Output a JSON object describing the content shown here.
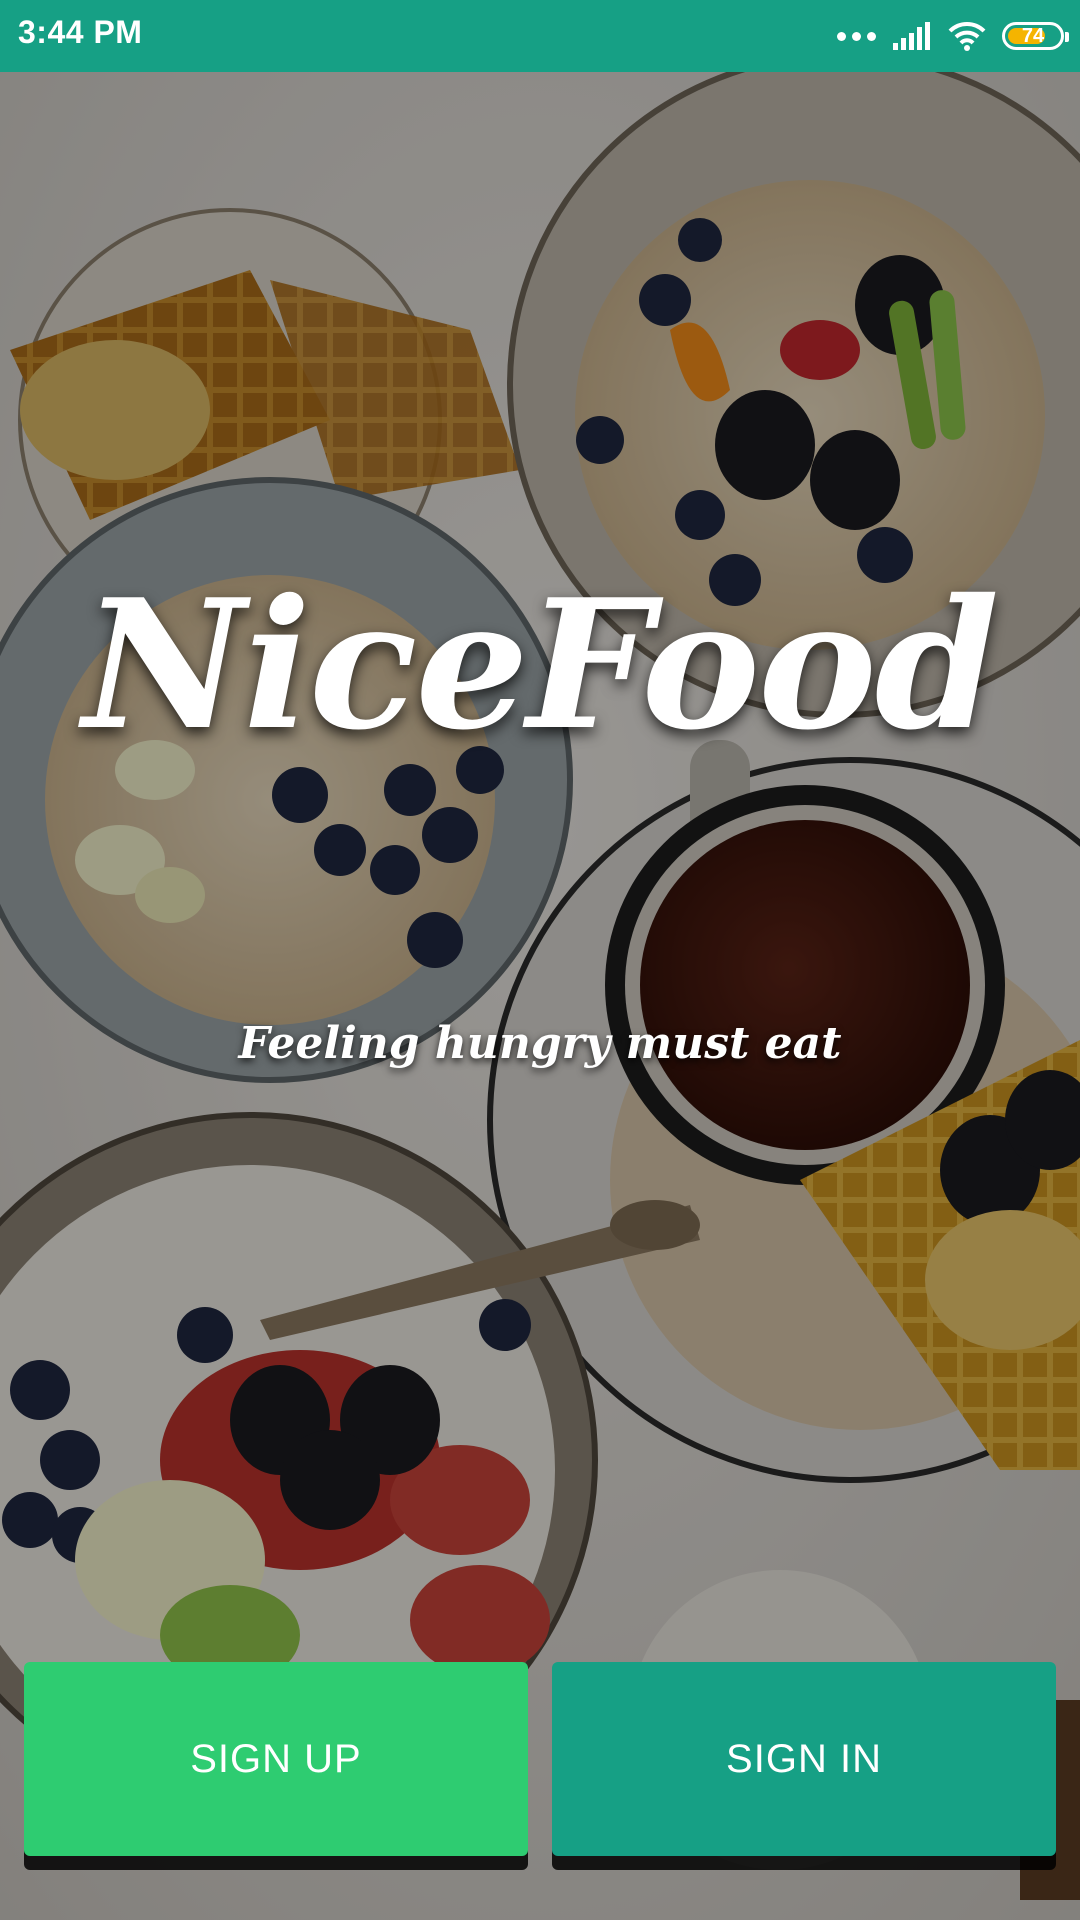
{
  "status_bar": {
    "time": "3:44 PM",
    "battery_level": "74",
    "battery_percent": 74,
    "icons": [
      "more-dots-icon",
      "signal-icon",
      "wifi-icon",
      "battery-icon"
    ]
  },
  "app": {
    "title": "NiceFood",
    "tagline": "Feeling hungry must eat"
  },
  "actions": {
    "sign_up_label": "SIGN UP",
    "sign_in_label": "SIGN IN"
  },
  "colors": {
    "status_bar": "#16a085",
    "sign_up": "#2ecc71",
    "sign_in": "#16a085",
    "battery_fill": "#f5b400"
  }
}
